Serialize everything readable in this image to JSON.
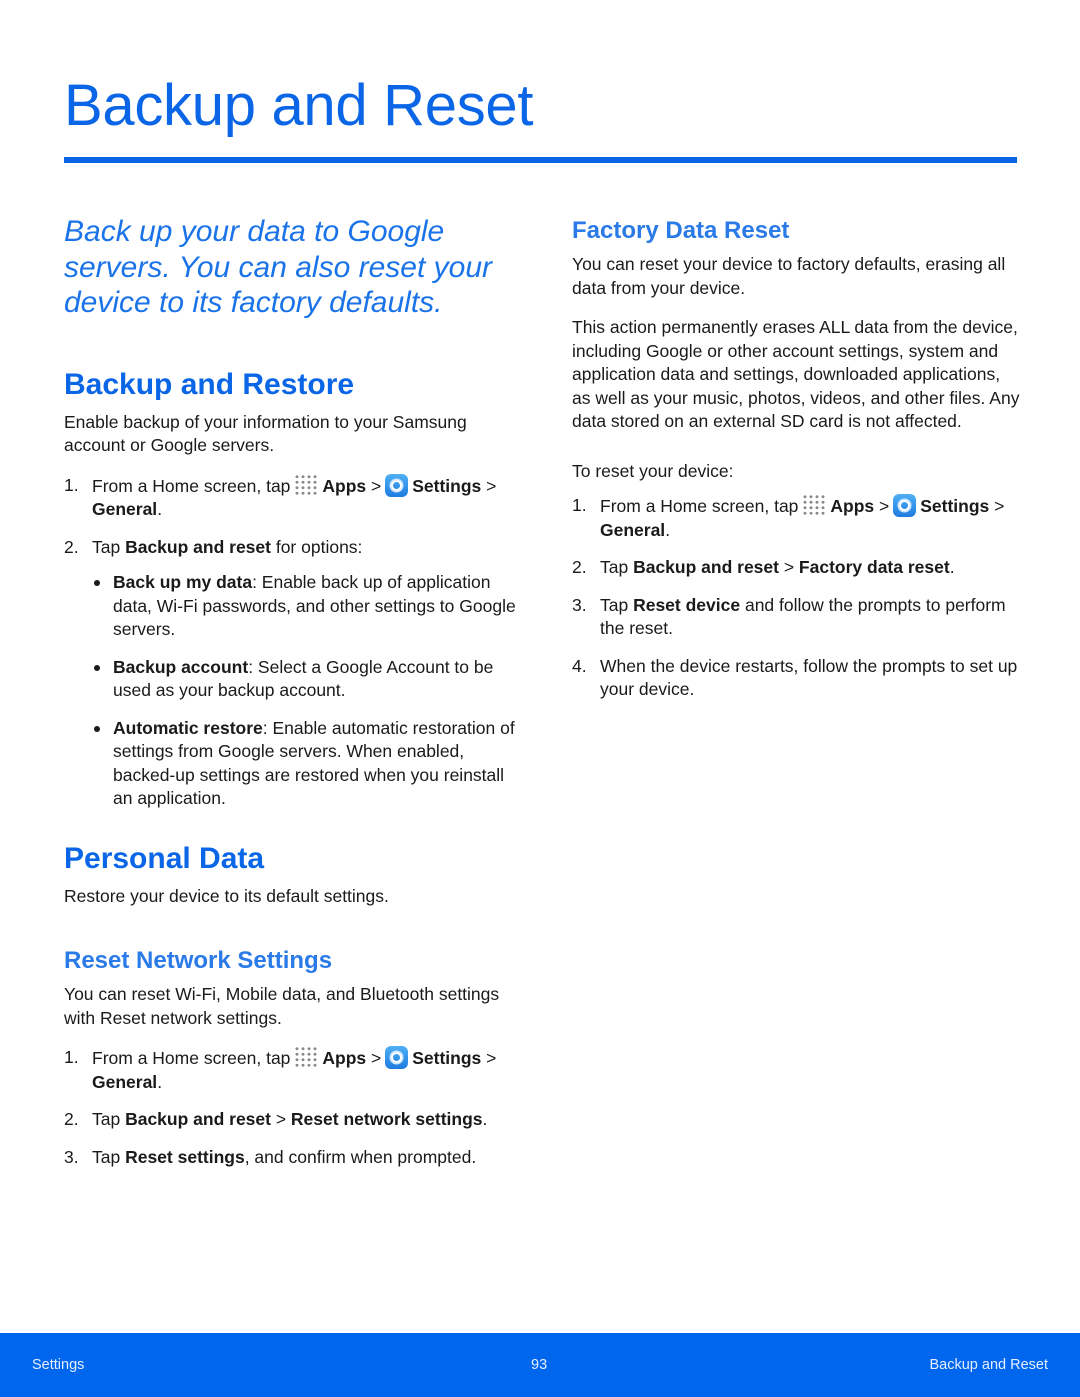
{
  "header": {
    "title": "Backup and Reset",
    "accent": "#0a66e6"
  },
  "intro": "Back up your data to Google servers. You can also reset your device to its factory defaults.",
  "backup_restore": {
    "heading": "Backup and Restore",
    "para": "Enable backup of your information to your Samsung account or Google servers.",
    "steps": [
      [
        {
          "t": "From a Home screen, tap"
        },
        {
          "i": "apps"
        },
        {
          "b": "Apps"
        },
        {
          "t": " >"
        },
        {
          "i": "settings"
        },
        {
          "b": "Settings"
        },
        {
          "t": " > "
        },
        {
          "b": "General"
        },
        {
          "t": "."
        }
      ],
      [
        {
          "t": "Tap "
        },
        {
          "b": "Backup and reset"
        },
        {
          "t": " for options:"
        }
      ]
    ],
    "bullets": [
      [
        {
          "b": "Back up my data"
        },
        {
          "t": ": Enable back up of application data, Wi-Fi passwords, and other settings to Google servers."
        }
      ],
      [
        {
          "b": "Backup account"
        },
        {
          "t": ": Select a Google Account to be used as your backup account."
        }
      ],
      [
        {
          "b": "Automatic restore"
        },
        {
          "t": ": Enable automatic restoration of settings from Google servers. When enabled, backed-up settings are restored when you reinstall an application."
        }
      ]
    ]
  },
  "personal_data": {
    "heading": "Personal Data",
    "para": "Restore your device to its default settings."
  },
  "reset_network": {
    "heading": "Reset Network Settings",
    "para": "You can reset Wi-Fi, Mobile data, and Bluetooth settings with Reset network settings.",
    "steps": [
      [
        {
          "t": "From a Home screen, tap"
        },
        {
          "i": "apps"
        },
        {
          "b": "Apps"
        },
        {
          "t": " >"
        },
        {
          "i": "settings"
        },
        {
          "b": "Settings"
        },
        {
          "t": " > "
        },
        {
          "b": "General"
        },
        {
          "t": "."
        }
      ],
      [
        {
          "t": "Tap "
        },
        {
          "b": "Backup and reset"
        },
        {
          "t": " > "
        },
        {
          "b": "Reset network settings"
        },
        {
          "t": "."
        }
      ],
      [
        {
          "t": "Tap "
        },
        {
          "b": "Reset settings"
        },
        {
          "t": ", and confirm when prompted."
        }
      ]
    ]
  },
  "factory_reset": {
    "heading": "Factory Data Reset",
    "para1": "You can reset your device to factory defaults, erasing all data from your device.",
    "para2": "This action permanently erases ALL data from the device, including Google or other account settings, system and application data and settings, downloaded applications, as well as your music, photos, videos, and other files. Any data stored on an external SD card is not affected.",
    "para3": "To reset your device:",
    "steps": [
      [
        {
          "t": "From a Home screen, tap"
        },
        {
          "i": "apps"
        },
        {
          "b": "Apps"
        },
        {
          "t": " >"
        },
        {
          "i": "settings"
        },
        {
          "b": "Settings"
        },
        {
          "t": " > "
        },
        {
          "b": "General"
        },
        {
          "t": "."
        }
      ],
      [
        {
          "t": "Tap "
        },
        {
          "b": "Backup and reset"
        },
        {
          "t": " > "
        },
        {
          "b": "Factory data reset"
        },
        {
          "t": "."
        }
      ],
      [
        {
          "t": "Tap "
        },
        {
          "b": "Reset device"
        },
        {
          "t": " and follow the prompts to perform the reset."
        }
      ],
      [
        {
          "t": "When the device restarts, follow the prompts to set up your device."
        }
      ]
    ]
  },
  "footer": {
    "left": "Settings",
    "page": "93",
    "right": "Backup and Reset",
    "color": "#0066ee"
  }
}
